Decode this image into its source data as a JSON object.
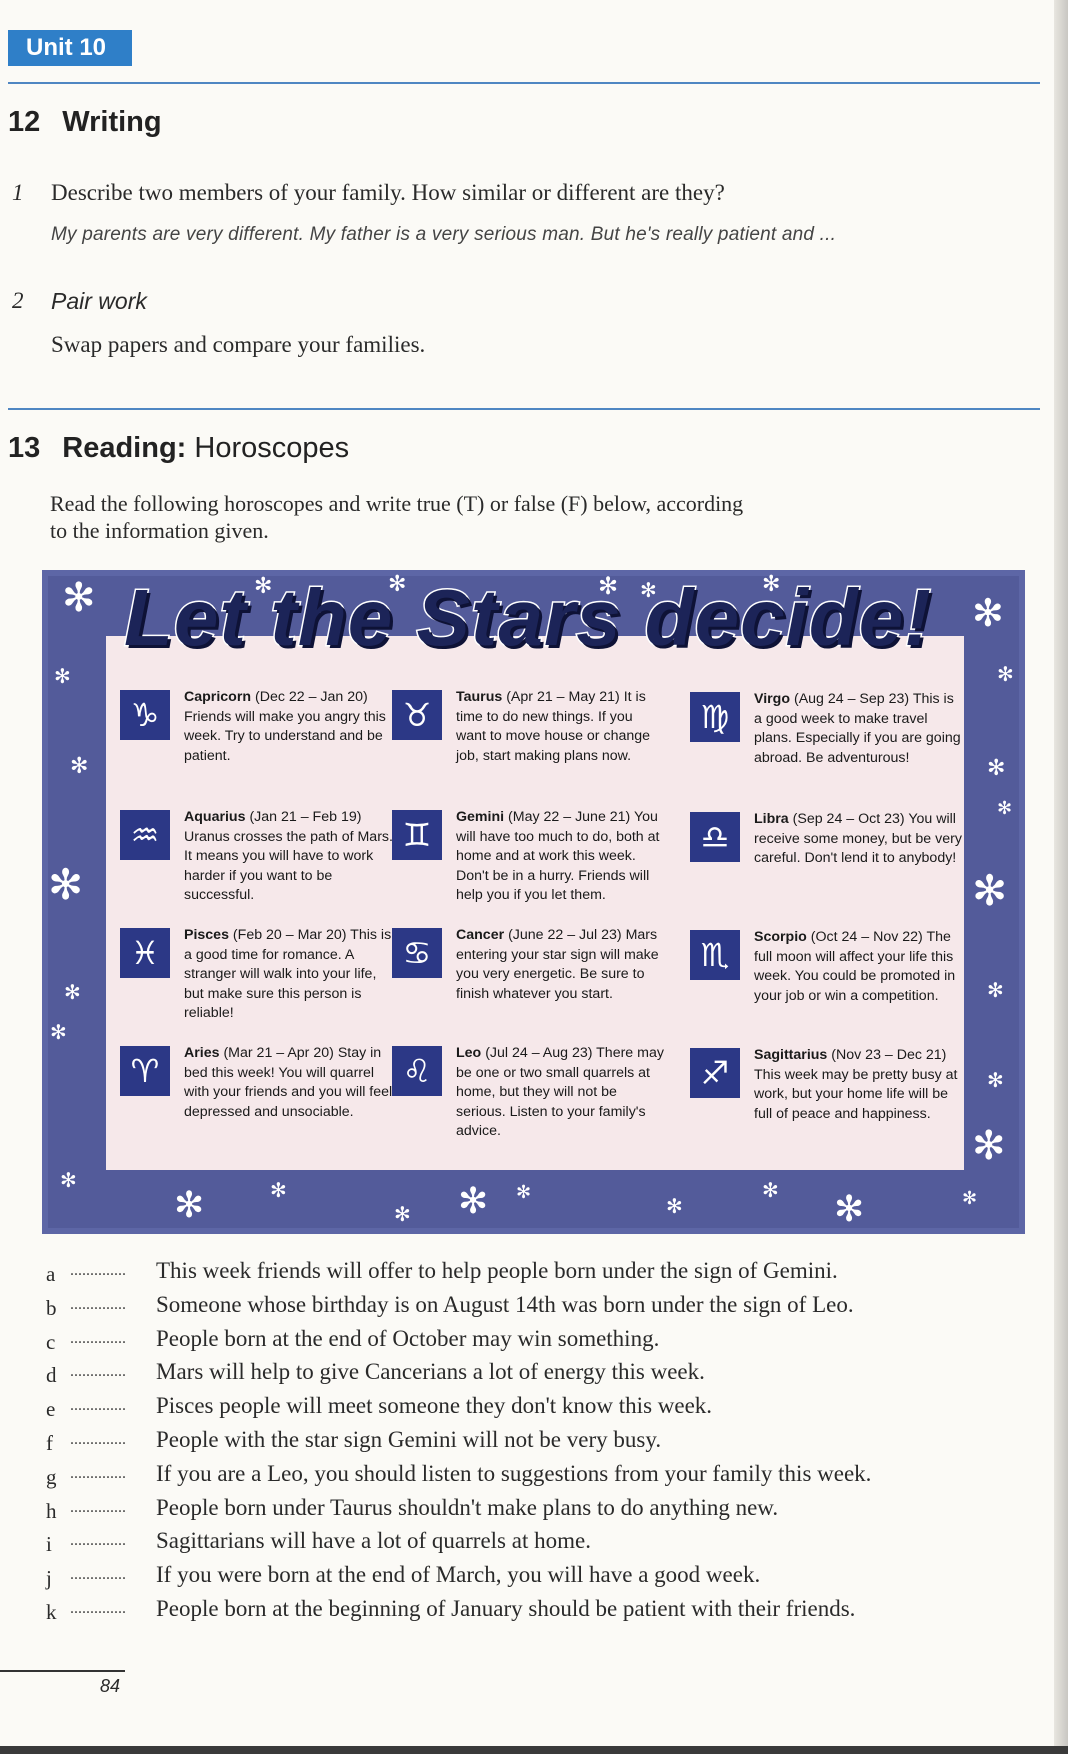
{
  "unit_tab": "Unit 10",
  "writing": {
    "number": "12",
    "title": "Writing",
    "q1_num": "1",
    "q1_text": "Describe two members of your family. How similar or different are they?",
    "q1_answer": "My parents are very different. My father is a very serious man. But he's really patient and ...",
    "q2_num": "2",
    "q2_title": "Pair work",
    "q2_text": "Swap papers and compare your families."
  },
  "reading": {
    "number": "13",
    "title_bold": "Reading:",
    "title_rest": "Horoscopes",
    "instructions": "Read the following horoscopes and write true (T) or false (F) below, according to the information given."
  },
  "poster": {
    "title": "Let the Stars decide!",
    "signs": [
      {
        "icon": "capricorn-icon",
        "glyph": "♑",
        "name": "Capricorn",
        "dates": "(Dec 22 – Jan 20)",
        "text": "Friends will make you angry this week. Try to understand and be patient."
      },
      {
        "icon": "taurus-icon",
        "glyph": "♉",
        "name": "Taurus",
        "dates": "(Apr 21 – May 21)",
        "text": "It is time to do new things. If you want to move house or change job, start making plans now."
      },
      {
        "icon": "virgo-icon",
        "glyph": "♍",
        "name": "Virgo",
        "dates": "(Aug 24 – Sep 23)",
        "text": "This is a good week to make travel plans. Especially if you are going abroad. Be adventurous!"
      },
      {
        "icon": "aquarius-icon",
        "glyph": "♒",
        "name": "Aquarius",
        "dates": "(Jan 21 – Feb 19)",
        "text": "Uranus crosses the path of Mars. It means you will have to work harder if you want to be successful."
      },
      {
        "icon": "gemini-icon",
        "glyph": "♊",
        "name": "Gemini",
        "dates": "(May 22 – June 21)",
        "text": "You will have too much to do, both at home and at work this week. Don't be in a hurry. Friends will help you if you let them."
      },
      {
        "icon": "libra-icon",
        "glyph": "♎",
        "name": "Libra",
        "dates": "(Sep 24 – Oct 23)",
        "text": "You will receive some money, but be very careful. Don't lend it to anybody!"
      },
      {
        "icon": "pisces-icon",
        "glyph": "♓",
        "name": "Pisces",
        "dates": "(Feb 20 – Mar 20)",
        "text": "This is a good time for romance. A stranger will walk into your life, but make sure this person is reliable!"
      },
      {
        "icon": "cancer-icon",
        "glyph": "♋",
        "name": "Cancer",
        "dates": "(June 22 – Jul 23)",
        "text": "Mars entering your star sign will make you very energetic. Be sure to finish whatever you start."
      },
      {
        "icon": "scorpio-icon",
        "glyph": "♏",
        "name": "Scorpio",
        "dates": "(Oct 24 – Nov 22)",
        "text": "The full moon will affect your life this week. You could be promoted in your job or win a competition."
      },
      {
        "icon": "aries-icon",
        "glyph": "♈",
        "name": "Aries",
        "dates": "(Mar 21 – Apr 20)",
        "text": "Stay in bed this week! You will quarrel with your friends and you will feel depressed and unsociable."
      },
      {
        "icon": "leo-icon",
        "glyph": "♌",
        "name": "Leo",
        "dates": "(Jul 24 – Aug 23)",
        "text": "There may be one or two small quarrels at home, but they will not be serious. Listen to your family's advice."
      },
      {
        "icon": "sagittarius-icon",
        "glyph": "♐",
        "name": "Sagittarius",
        "dates": "(Nov 23 – Dec 21)",
        "text": "This week may be pretty busy at work, but your home life will be full of peace and happiness."
      }
    ]
  },
  "true_false": {
    "blank": "..............",
    "items": [
      {
        "letter": "a",
        "text": "This week friends will offer to help people born under the sign of Gemini."
      },
      {
        "letter": "b",
        "text": "Someone whose birthday is on August 14th was born under the sign of Leo."
      },
      {
        "letter": "c",
        "text": "People born at the end of October may win something."
      },
      {
        "letter": "d",
        "text": "Mars will help to give Cancerians a lot of energy this week."
      },
      {
        "letter": "e",
        "text": "Pisces people will meet someone they don't know this week."
      },
      {
        "letter": "f",
        "text": "People with the star sign Gemini will not be very busy."
      },
      {
        "letter": "g",
        "text": "If you are a Leo, you should listen to suggestions from your family this week."
      },
      {
        "letter": "h",
        "text": "People born under Taurus shouldn't make plans to do anything new."
      },
      {
        "letter": "i",
        "text": "Sagittarians will have a lot of quarrels at home."
      },
      {
        "letter": "j",
        "text": "If you were born at the end of March, you will have a good week."
      },
      {
        "letter": "k",
        "text": "People born at the beginning of January should be patient with their friends."
      }
    ]
  },
  "page_number": "84",
  "colors": {
    "accent_blue": "#2f7fc8",
    "poster_frame": "#535b9a",
    "poster_panel": "#f6e8ea",
    "icon_bg": "#2c3886"
  }
}
